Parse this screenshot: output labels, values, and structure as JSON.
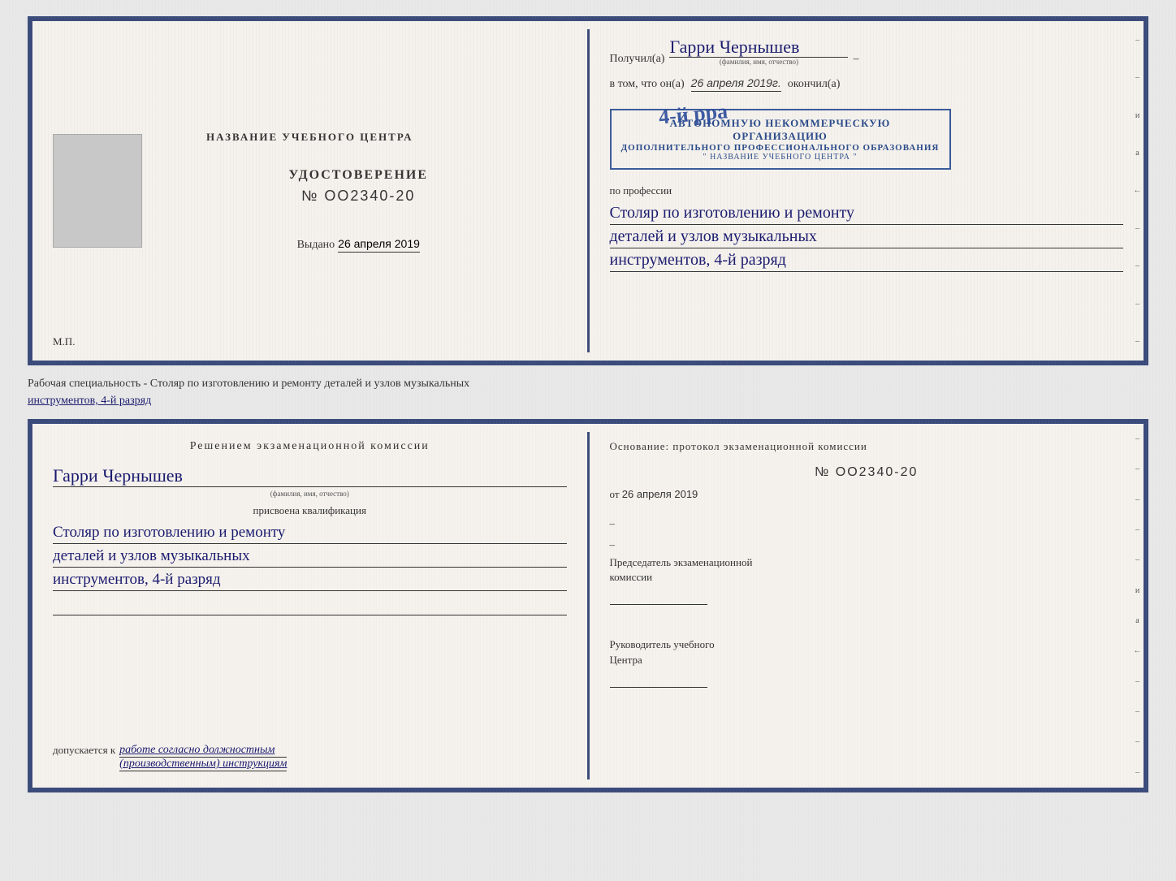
{
  "top_doc": {
    "left": {
      "center_title": "НАЗВАНИЕ УЧЕБНОГО ЦЕНТРА",
      "cert_type": "УДОСТОВЕРЕНИЕ",
      "cert_number": "№ OO2340-20",
      "issued_label": "Выдано",
      "issued_date": "26 апреля 2019",
      "mp_label": "М.П."
    },
    "right": {
      "recipient_label": "Получил(а)",
      "recipient_name": "Гарри Чернышев",
      "recipient_hint": "(фамилия, имя, отчество)",
      "in_that_label": "в том, что он(а)",
      "date_val": "26 апреля 2019г.",
      "okonchl_label": "окончил(а)",
      "stamp_line1": "АВТОНОМНУЮ НЕКОММЕРЧЕСКУЮ ОРГАНИЗАЦИЮ",
      "stamp_line2": "ДОПОЛНИТЕЛЬНОГО ПРОФЕССИОНАЛЬНОГО ОБРАЗОВАНИЯ",
      "stamp_line3": "\" НАЗВАНИЕ УЧЕБНОГО ЦЕНТРА \"",
      "stamp_overlay": "4-й рра",
      "profession_label": "по профессии",
      "profession_line1": "Столяр по изготовлению и ремонту",
      "profession_line2": "деталей и узлов музыкальных",
      "profession_line3": "инструментов, 4-й разряд"
    }
  },
  "caption": {
    "text1": "Рабочая специальность - Столяр по изготовлению и ремонту деталей и узлов музыкальных",
    "text2": "инструментов, 4-й разряд"
  },
  "bottom_doc": {
    "left": {
      "decision_title": "Решением  экзаменационной  комиссии",
      "name": "Гарри Чернышев",
      "name_hint": "(фамилия, имя, отчество)",
      "kvali_label": "присвоена квалификация",
      "prof_line1": "Столяр по изготовлению и ремонту",
      "prof_line2": "деталей и узлов музыкальных",
      "prof_line3": "инструментов, 4-й разряд",
      "dopusk_label": "допускается к",
      "dopusk_value": "работе согласно должностным",
      "dopusk_value2": "(производственным) инструкциям"
    },
    "right": {
      "osnov_title": "Основание:  протокол  экзаменационной  комиссии",
      "protocol_num": "№  OO2340-20",
      "ot_label": "от",
      "protocol_date": "26 апреля 2019",
      "chairman_label1": "Председатель экзаменационной",
      "chairman_label2": "комиссии",
      "rukovod_label1": "Руководитель учебного",
      "rukovod_label2": "Центра"
    }
  },
  "vertical_marks": [
    "–",
    "–",
    "и",
    "а",
    "←",
    "–",
    "–",
    "–",
    "–"
  ],
  "v_marks_bottom": [
    "–",
    "–",
    "–",
    "–",
    "–",
    "и",
    "а",
    "←",
    "–",
    "–",
    "–",
    "–"
  ]
}
